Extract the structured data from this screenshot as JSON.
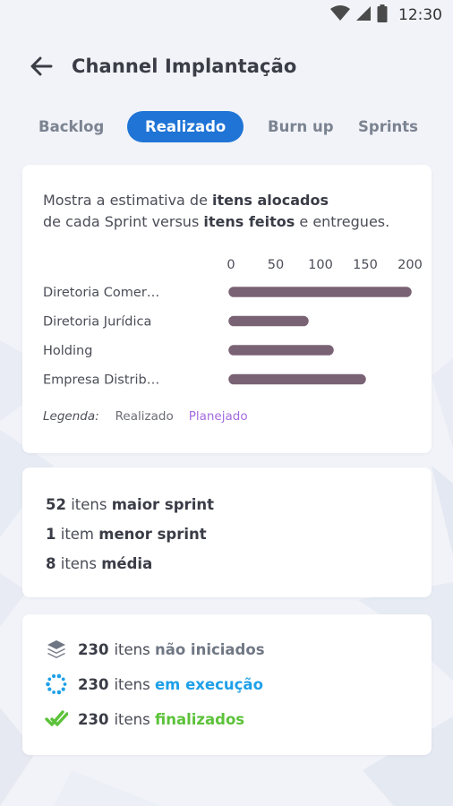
{
  "status_bar": {
    "time": "12:30"
  },
  "app": {
    "title": "Channel Implantação"
  },
  "tabs": [
    {
      "label": "Backlog"
    },
    {
      "label": "Realizado",
      "active": true
    },
    {
      "label": "Burn up"
    },
    {
      "label": "Sprints"
    }
  ],
  "description": {
    "part1": "Mostra a estimativa de ",
    "bold1": "itens alocados",
    "part2": "de cada Sprint versus ",
    "bold2": "itens feitos",
    "part3": " e entregues."
  },
  "chart_data": {
    "type": "bar",
    "orientation": "horizontal",
    "categories": [
      "Diretoria Comer…",
      "Diretoria Jurídica",
      "Holding",
      "Empresa Distrib…"
    ],
    "values": [
      200,
      85,
      113,
      149
    ],
    "xlim": [
      0,
      200
    ],
    "xticks": [
      0,
      50,
      100,
      150,
      200
    ],
    "bar_color": "#7a6275"
  },
  "legend": {
    "label": "Legenda:",
    "realizado": "Realizado",
    "planejado": "Planejado",
    "planejado_color": "#a56be0"
  },
  "sprint_stats": [
    {
      "value": "52",
      "unit": " itens ",
      "label": "maior sprint"
    },
    {
      "value": "1",
      "unit": " item ",
      "label": "menor sprint"
    },
    {
      "value": "8",
      "unit": " itens ",
      "label": "média"
    }
  ],
  "item_status": [
    {
      "icon": "layers-icon",
      "value": "230",
      "unit": "itens ",
      "label": "não iniciados",
      "color": "#707784"
    },
    {
      "icon": "loading-icon",
      "value": "230",
      "unit": "itens ",
      "label": "em execução",
      "color": "#1ea0e8"
    },
    {
      "icon": "double-check-icon",
      "value": "230",
      "unit": "itens ",
      "label": "finalizados",
      "color": "#5cc23a"
    }
  ]
}
